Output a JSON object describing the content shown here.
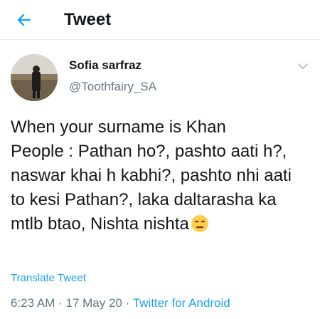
{
  "header": {
    "title": "Tweet",
    "back_icon": "arrow-left-icon",
    "accent_color": "#1da1f2"
  },
  "tweet": {
    "author": {
      "display_name": "Sofia sarfraz",
      "handle": "@Toothfairy_SA"
    },
    "text": "When your surname is Khan\nPeople : Pathan ho?, pashto aati h?, naswar khai h kabhi?, pashto nhi aati to kesi Pathan?, laka daltarasha ka mtlb btao, Nishta nishta",
    "emoji": "expressionless-face-emoji",
    "translate_label": "Translate Tweet",
    "time": "6:23 AM",
    "separator": " · ",
    "date": "17 May 20",
    "source": "Twitter for Android"
  }
}
